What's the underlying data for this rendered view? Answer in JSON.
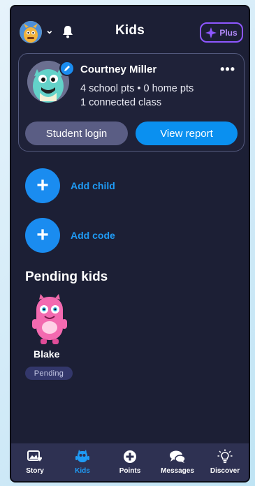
{
  "header": {
    "title": "Kids",
    "plus_label": "Plus"
  },
  "profile": {
    "name": "Courtney Miller",
    "points_summary": "4 school pts • 0 home pts",
    "classes_summary": "1 connected class",
    "more_label": "•••",
    "student_login_label": "Student login",
    "view_report_label": "View report"
  },
  "actions": {
    "add_child_label": "Add child",
    "add_code_label": "Add code"
  },
  "pending": {
    "section_title": "Pending kids",
    "kids": [
      {
        "name": "Blake",
        "status": "Pending"
      }
    ]
  },
  "tabs": [
    {
      "label": "Story",
      "icon": "story-icon"
    },
    {
      "label": "Kids",
      "icon": "kids-icon",
      "active": true
    },
    {
      "label": "Points",
      "icon": "points-icon"
    },
    {
      "label": "Messages",
      "icon": "messages-icon"
    },
    {
      "label": "Discover",
      "icon": "discover-icon"
    }
  ],
  "colors": {
    "background": "#1c1f35",
    "accent": "#1a8cf0",
    "plus": "#8e57ff",
    "tabbar": "#2e3152"
  }
}
